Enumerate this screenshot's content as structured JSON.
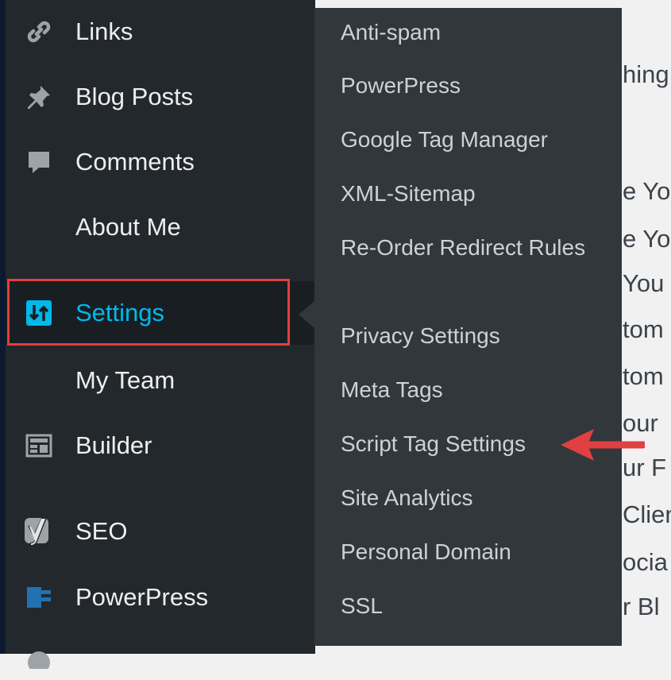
{
  "sidebar": {
    "items": [
      {
        "label": "Links",
        "icon": "link-icon"
      },
      {
        "label": "Blog Posts",
        "icon": "pin-icon"
      },
      {
        "label": "Comments",
        "icon": "comment-icon"
      },
      {
        "label": "About Me",
        "icon": ""
      },
      {
        "label": "Settings",
        "icon": "settings-icon",
        "active": true
      },
      {
        "label": "My Team",
        "icon": ""
      },
      {
        "label": "Builder",
        "icon": "builder-icon"
      },
      {
        "label": "SEO",
        "icon": "yoast-icon"
      },
      {
        "label": "PowerPress",
        "icon": "podcast-icon"
      }
    ]
  },
  "settings_submenu": {
    "items": [
      "Anti-spam",
      "PowerPress",
      "Google Tag Manager",
      "XML-Sitemap",
      "Re-Order Redirect Rules",
      "Privacy Settings",
      "Meta Tags",
      "Script Tag Settings",
      "Site Analytics",
      "Personal Domain",
      "SSL"
    ]
  },
  "content_fragments": [
    "hing",
    "e You",
    "e You",
    "You",
    "tom",
    "tom",
    "our",
    "ur F",
    "Clien",
    "ocia",
    "r Bl"
  ],
  "colors": {
    "sidebar_bg": "#23282d",
    "submenu_bg": "#32373c",
    "active_text": "#00b9eb",
    "annotation_red": "#e0403f"
  }
}
